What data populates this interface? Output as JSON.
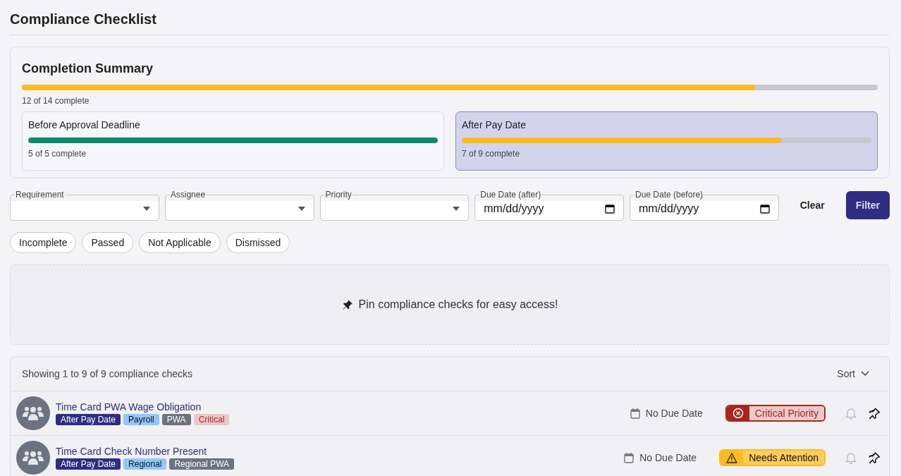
{
  "title": "Compliance Checklist",
  "summary": {
    "title": "Completion Summary",
    "level": 0.857,
    "caption": "12 of 14 complete",
    "groups": [
      {
        "title": "Before Approval Deadline",
        "level": 1,
        "color": "#0f8a6a",
        "caption": "5 of 5 complete",
        "selected": false
      },
      {
        "title": "After Pay Date",
        "level": 0.78,
        "color": "#fbbb21",
        "caption": "7 of 9 complete",
        "selected": true
      }
    ]
  },
  "filters": [
    {
      "kind": "select",
      "label": "Requirement"
    },
    {
      "kind": "select",
      "label": "Assignee"
    },
    {
      "kind": "select",
      "label": "Priority"
    },
    {
      "kind": "date",
      "label": "Due Date (after)",
      "placeholder": "mm/dd/yyyy"
    },
    {
      "kind": "date",
      "label": "Due Date (before)",
      "placeholder": "mm/dd/yyyy"
    }
  ],
  "clear_button": "Clear",
  "filter_button": "Filter",
  "status_chips": [
    "Incomplete",
    "Passed",
    "Not Applicable",
    "Dismissed"
  ],
  "pin_hint": "Pin compliance checks for easy access!",
  "list": {
    "summary": "Showing 1 to 9 of 9 compliance checks",
    "sort": "Sort",
    "rows": [
      {
        "title": "Time Card PWA Wage Obligation",
        "tags": [
          {
            "label": "After Pay Date",
            "color": "#2e2d82"
          },
          {
            "label": "Payroll",
            "color": "#90c8fb"
          },
          {
            "label": "PWA",
            "color": "#6b7280"
          },
          {
            "label": "Critical",
            "color": "#e8c8cb"
          }
        ],
        "due": "No Due Date",
        "status": {
          "kind": "critical",
          "label": "Critical Priority"
        }
      },
      {
        "title": "Time Card Check Number Present",
        "tags": [
          {
            "label": "After Pay Date",
            "color": "#2e2d82"
          },
          {
            "label": "Regional",
            "color": "#90c8fb"
          },
          {
            "label": "Regional PWA",
            "color": "#6b7280"
          }
        ],
        "due": "No Due Date",
        "status": {
          "kind": "warning",
          "label": "Needs Attention"
        }
      }
    ]
  }
}
